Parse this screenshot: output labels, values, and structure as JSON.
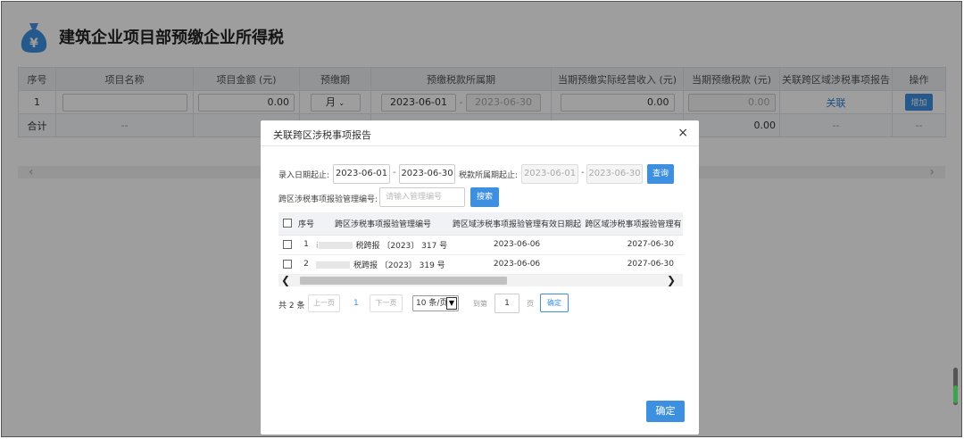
{
  "page": {
    "title": "建筑企业项目部预缴企业所得税",
    "colors": {
      "accent": "#3d8fe0",
      "header_bg": "#eceff3"
    }
  },
  "main_table": {
    "headers": [
      "序号",
      "项目名称",
      "项目金额 (元)",
      "预缴期",
      "预缴税款所属期",
      "当期预缴实际经营收入 (元)",
      "当期预缴税款 (元)",
      "关联跨区域涉税事项报告",
      "操作"
    ],
    "row": {
      "index": "1",
      "amount": "0.00",
      "period": "月",
      "period_start": "2023-06-01",
      "period_end": "2023-06-30",
      "revenue": "0.00",
      "tax": "0.00",
      "link": "关联",
      "op": "增加"
    },
    "total": {
      "label": "合计",
      "name": "--",
      "tax": "0.00",
      "link": "--",
      "op": "--"
    }
  },
  "modal": {
    "title": "关联跨区涉税事项报告",
    "close": "×",
    "entry_date_label": "录入日期起止:",
    "entry_start": "2023-06-01",
    "entry_end": "2023-06-30",
    "tax_period_label": "税款所属期起止:",
    "tax_start": "2023-06-01",
    "tax_end": "2023-06-30",
    "query_btn": "查询",
    "mgmt_no_label": "跨区涉税事项报验管理编号:",
    "mgmt_no_placeholder": "请输入管理编号",
    "search_btn": "搜索",
    "table": {
      "headers": [
        "序号",
        "跨区涉税事项报验管理编号",
        "跨区域涉税事项报验管理有效日期起",
        "跨区域涉税事项报验管理有"
      ],
      "rows": [
        {
          "index": "1",
          "prefix": "i",
          "code": "税跨报 〔2023〕 317 号",
          "start": "2023-06-06",
          "end": "2027-06-30"
        },
        {
          "index": "2",
          "prefix": "",
          "code": "税跨报 〔2023〕 319 号",
          "start": "2023-06-06",
          "end": "2027-06-30"
        }
      ]
    },
    "pagination": {
      "total": "共 2 条",
      "prev": "上一页",
      "page": "1",
      "next": "下一页",
      "size": "10 条/页",
      "goto": "到第",
      "goto_page": "1",
      "unit": "页",
      "goto_btn": "确定"
    },
    "confirm": "确定"
  }
}
